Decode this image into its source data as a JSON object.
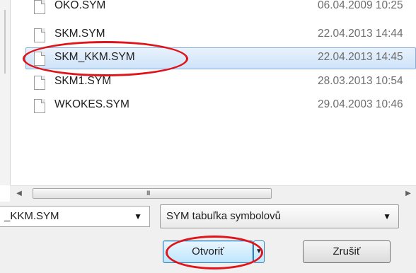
{
  "files": [
    {
      "name": "OKO.SYM",
      "date": "06.04.2009 10:25",
      "selected": false
    },
    {
      "name": "SKM.SYM",
      "date": "22.04.2013 14:44",
      "selected": false
    },
    {
      "name": "SKM_KKM.SYM",
      "date": "22.04.2013 14:45",
      "selected": true
    },
    {
      "name": "SKM1.SYM",
      "date": "28.03.2013 10:54",
      "selected": false
    },
    {
      "name": "WKOKES.SYM",
      "date": "29.04.2003 10:46",
      "selected": false
    }
  ],
  "scrollbar": {
    "grip": "III",
    "left_arrow": "◀",
    "right_arrow": "▶"
  },
  "filename_field": {
    "value": "_KKM.SYM",
    "arrow": "▼"
  },
  "filetype_select": {
    "value": "SYM tabuľka symbolovů",
    "arrow": "▼"
  },
  "buttons": {
    "open": "Otvoriť",
    "open_split_arrow": "▼",
    "cancel": "Zrušiť"
  },
  "colors": {
    "annotation": "#e0141b",
    "selection": "#cfe3f9",
    "date_text": "#6d6d6d"
  },
  "icons": {
    "file": "file-icon"
  }
}
